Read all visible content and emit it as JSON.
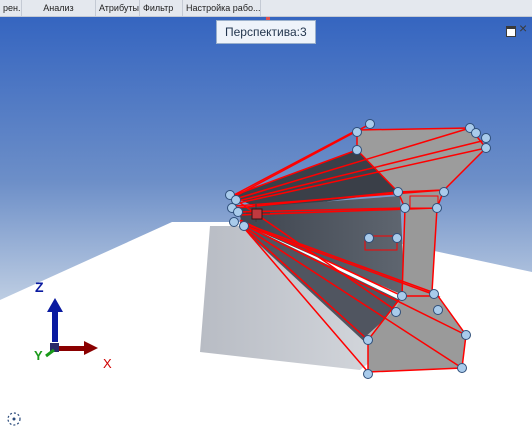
{
  "menu": {
    "items": [
      {
        "label": "рен..."
      },
      {
        "label": "Анализ"
      },
      {
        "label": "Атрибуты"
      },
      {
        "label": "Фильтр"
      },
      {
        "label": "Настройка рабо..."
      }
    ]
  },
  "viewport": {
    "label": "Перспектива:3"
  },
  "axes": {
    "x": "X",
    "y": "Y",
    "z": "Z",
    "colors": {
      "x": "#c00000",
      "y": "#1a9a1a",
      "z": "#0a1aa0"
    }
  },
  "colors": {
    "sky_top": "#3c6fc4",
    "sky_horizon": "#c9d6e6",
    "ground": "#ffffff",
    "model_face": "#9a9a9a",
    "edge": "#ff0000",
    "handle": "#a9cbeb"
  },
  "icons": {
    "maximize": "maximize-icon",
    "close": "close-icon",
    "navigation": "navigation-cube-icon",
    "gizmo": "move-gizmo-icon"
  }
}
